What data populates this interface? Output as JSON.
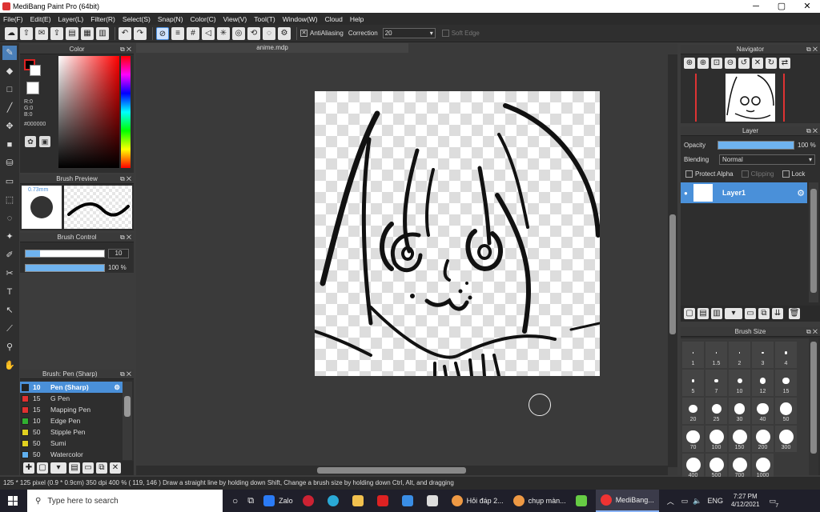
{
  "window": {
    "title": "MediBang Paint Pro (64bit)",
    "min": "─",
    "max": "▢",
    "close": "✕"
  },
  "menu": [
    "File(F)",
    "Edit(E)",
    "Layer(L)",
    "Filter(R)",
    "Select(S)",
    "Snap(N)",
    "Color(C)",
    "View(V)",
    "Tool(T)",
    "Window(W)",
    "Cloud",
    "Help"
  ],
  "toolbar": {
    "antialiasing": "AntiAliasing",
    "correction_label": "Correction",
    "correction_value": "20",
    "soft_edge": "Soft Edge"
  },
  "color_panel": {
    "title": "Color",
    "r": "R:0",
    "g": "G:0",
    "b": "B:0",
    "hex": "#000000"
  },
  "brush_preview": {
    "title": "Brush Preview",
    "size": "0.73mm"
  },
  "brush_control": {
    "title": "Brush Control",
    "size_value": "10",
    "opacity_value": "100 %"
  },
  "brush_list": {
    "title": "Brush: Pen (Sharp)",
    "items": [
      {
        "size": "10",
        "name": "Pen (Sharp)",
        "color": "#222222"
      },
      {
        "size": "15",
        "name": "G Pen",
        "color": "#e03030"
      },
      {
        "size": "15",
        "name": "Mapping Pen",
        "color": "#e03030"
      },
      {
        "size": "10",
        "name": "Edge Pen",
        "color": "#30b030"
      },
      {
        "size": "50",
        "name": "Stipple Pen",
        "color": "#e0d020"
      },
      {
        "size": "50",
        "name": "Sumi",
        "color": "#e0d020"
      },
      {
        "size": "50",
        "name": "Watercolor",
        "color": "#60b0f0"
      }
    ]
  },
  "document": {
    "tab": "anime.mdp"
  },
  "navigator": {
    "title": "Navigator"
  },
  "layer_panel": {
    "title": "Layer",
    "opacity_label": "Opacity",
    "opacity_value": "100 %",
    "opacity_fraction": 1.0,
    "blending_label": "Blending",
    "blending_value": "Normal",
    "protect_alpha": "Protect Alpha",
    "clipping": "Clipping",
    "lock": "Lock",
    "layer_name": "Layer1"
  },
  "brush_size": {
    "title": "Brush Size",
    "sizes": [
      "1",
      "1.5",
      "2",
      "3",
      "4",
      "5",
      "7",
      "10",
      "12",
      "15",
      "20",
      "25",
      "30",
      "40",
      "50",
      "70",
      "100",
      "150",
      "200",
      "300",
      "400",
      "500",
      "700",
      "1000"
    ]
  },
  "status": {
    "text": "125 * 125 pixel  (0.9 * 0.9cm)  350 dpi  400 %  ( 119, 146 )  Draw a straight line by holding down Shift, Change a brush size by holding down Ctrl, Alt, and dragging"
  },
  "taskbar": {
    "search_placeholder": "Type here to search",
    "zalo": "Zalo",
    "hoi_dap": "Hỏi đáp 2...",
    "chup_man": "chụp màn...",
    "medibang": "MediBang...",
    "lang": "ENG",
    "time": "7:27 PM",
    "date": "4/12/2021",
    "notif": "7"
  }
}
